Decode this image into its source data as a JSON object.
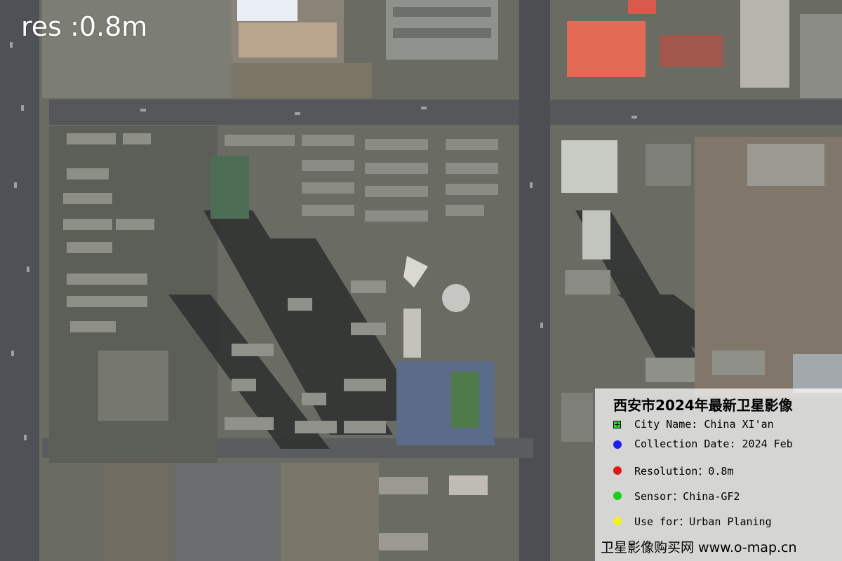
{
  "overlay": {
    "resolution_label": "res :0.8m"
  },
  "legend": {
    "title": "西安市2024年最新卫星影像",
    "rows": [
      {
        "text": "City Name: China XI'an",
        "color": "#2fd62f",
        "icon": "city-marker-icon"
      },
      {
        "text": "Collection Date: 2024 Feb",
        "color": "#1d1df0",
        "icon": "blue-dot-icon"
      },
      {
        "text": "Resolution：0.8m",
        "color": "#e01818",
        "icon": "red-dot-icon"
      },
      {
        "text": "Sensor：China-GF2",
        "color": "#18d018",
        "icon": "green-dot-icon"
      },
      {
        "text": "Use for：Urban Planing",
        "color": "#f2f21a",
        "icon": "yellow-dot-icon"
      }
    ],
    "footer": "卫星影像购买网 www.o-map.cn"
  }
}
